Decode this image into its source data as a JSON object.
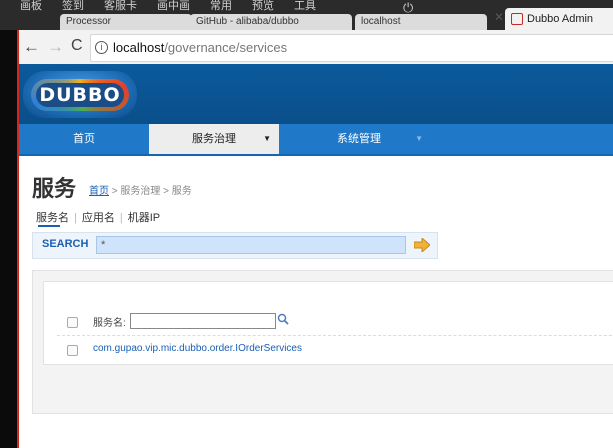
{
  "browser": {
    "bookmarks": [
      "画板",
      "签到",
      "客服卡",
      "画中画",
      "常用",
      "预览",
      "工具"
    ],
    "faded_tabs": [
      "Processor",
      "GitHub - alibaba/dubbo",
      "localhost"
    ],
    "active_tab": "Dubbo Admin",
    "url_host": "localhost",
    "url_path": "/governance/services"
  },
  "header": {
    "logo_text": "DUBBO"
  },
  "nav": {
    "home": "首页",
    "service_governance": "服务治理",
    "system_management": "系统管理"
  },
  "page": {
    "title": "服务",
    "breadcrumb_home": "首页",
    "breadcrumb_rest": " > 服务治理 > 服务"
  },
  "sub_tabs": [
    "服务名",
    "应用名",
    "机器IP"
  ],
  "search": {
    "label": "SEARCH",
    "value": "*"
  },
  "table": {
    "header_label": "服务名:",
    "rows": [
      "com.gupao.vip.mic.dubbo.order.IOrderServices"
    ]
  },
  "colors": {
    "nav_blue": "#1f78c8",
    "header_blue": "#0b5a9c",
    "link_blue": "#1a5fb4",
    "accent_red": "#d7261c"
  }
}
